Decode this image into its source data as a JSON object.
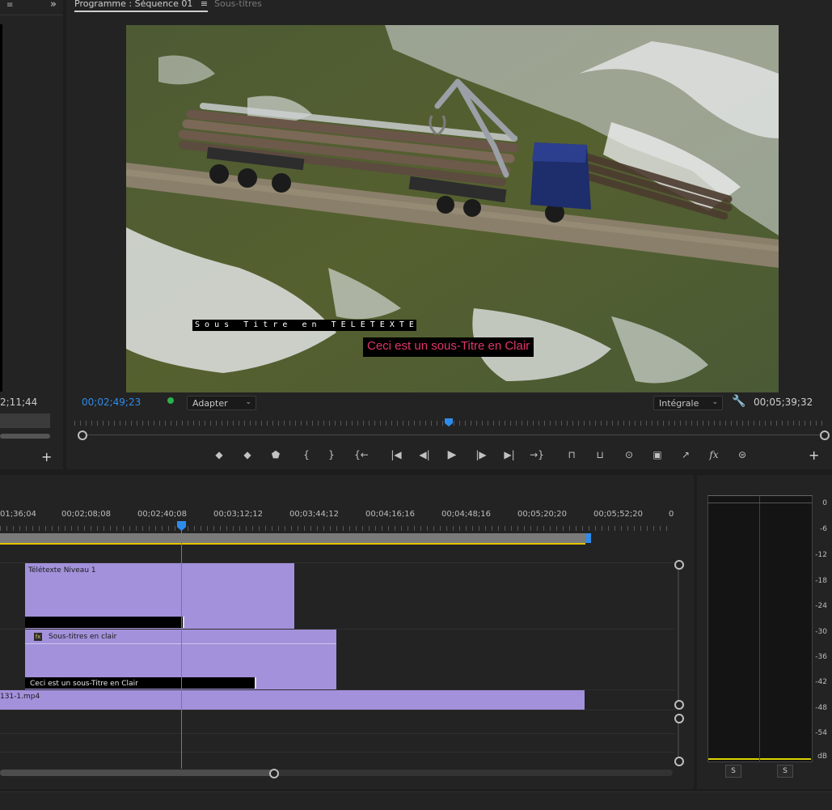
{
  "left_panel": {
    "timecode": "2;11;44",
    "overflow_icon": "double-chevron-right-icon"
  },
  "program": {
    "tab_title": "Programme : Séquence 01",
    "tab_menu_icon": "hamburger-icon",
    "tab_secondary": "Sous-titres",
    "caption_teletext": "S o u s   T i t r e   e n   T E L E T E X T E",
    "caption_open": "Ceci est un sous-Titre en Clair",
    "current_timecode": "00;02;49;23",
    "fit_select": "Adapter",
    "resolution_select": "Intégrale",
    "duration_timecode": "00;05;39;32",
    "accent_color": "#2d8ceb",
    "caption_color": "#e0356a"
  },
  "transport": {
    "buttons": [
      {
        "name": "add-marker-button",
        "glyph": "◆"
      },
      {
        "name": "go-to-marker-button",
        "glyph": "◆"
      },
      {
        "name": "marker-button",
        "glyph": "⬟"
      },
      {
        "name": "mark-in-button",
        "glyph": "{"
      },
      {
        "name": "mark-out-button",
        "glyph": "}"
      },
      {
        "name": "go-to-in-button",
        "glyph": "{←"
      },
      {
        "name": "step-back-edit-button",
        "glyph": "|◀"
      },
      {
        "name": "step-back-frame-button",
        "glyph": "◀|"
      },
      {
        "name": "play-button",
        "glyph": "▶"
      },
      {
        "name": "step-forward-frame-button",
        "glyph": "|▶"
      },
      {
        "name": "step-forward-edit-button",
        "glyph": "▶|"
      },
      {
        "name": "go-to-out-button",
        "glyph": "→}"
      },
      {
        "name": "lift-button",
        "glyph": "⊓"
      },
      {
        "name": "extract-button",
        "glyph": "⊔"
      },
      {
        "name": "export-frame-button",
        "glyph": "⊙"
      },
      {
        "name": "comparison-view-button",
        "glyph": "▣"
      },
      {
        "name": "share-button",
        "glyph": "↗"
      },
      {
        "name": "effects-button",
        "glyph": "fx"
      },
      {
        "name": "vr-button",
        "glyph": "⊜"
      }
    ]
  },
  "timeline": {
    "ruler_labels": [
      "01;36;04",
      "00;02;08;08",
      "00;02;40;08",
      "00;03;12;12",
      "00;03;44;12",
      "00;04;16;16",
      "00;04;48;16",
      "00;05;20;20",
      "00;05;52;20",
      "0"
    ],
    "clip_teletext_title": "Télétexte Niveau 1",
    "clip_open_title": "Sous-titres en clair",
    "clip_open_caption": "Ceci est un sous-Titre en Clair",
    "clip_video": "131-1.mp4",
    "fx_badge": "fx"
  },
  "audio_meter": {
    "db_labels": [
      "0",
      "-6",
      "-12",
      "-18",
      "-24",
      "-30",
      "-36",
      "-42",
      "-48",
      "-54",
      "dB"
    ],
    "solo_left": "S",
    "solo_right": "S"
  }
}
